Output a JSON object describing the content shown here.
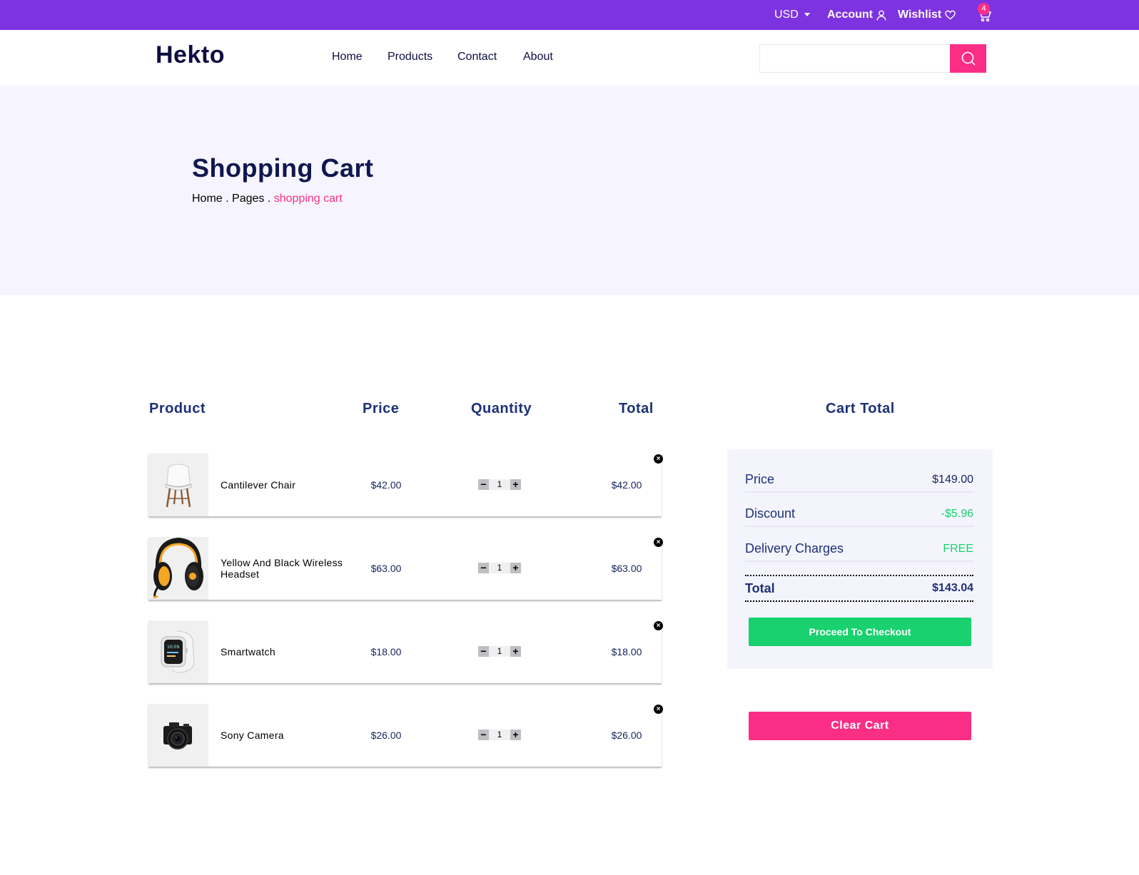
{
  "topbar": {
    "currency": "USD",
    "account": "Account",
    "wishlist": "Wishlist",
    "cart_count": "4",
    "bg_color": "#7e33e0"
  },
  "header": {
    "logo": "Hekto",
    "nav": [
      "Home",
      "Products",
      "Contact",
      "About"
    ],
    "search_placeholder": ""
  },
  "hero": {
    "title": "Shopping Cart",
    "breadcrumb": [
      "Home",
      "Pages",
      "shopping cart"
    ]
  },
  "table": {
    "headers": [
      "Product",
      "Price",
      "Quantity",
      "Total"
    ],
    "rows": [
      {
        "name": "Cantilever Chair",
        "price": "$42.00",
        "qty": "1",
        "total": "$42.00",
        "image_icon": "chair-image"
      },
      {
        "name": "Yellow And Black Wireless Headset",
        "price": "$63.00",
        "qty": "1",
        "total": "$63.00",
        "image_icon": "headset-image"
      },
      {
        "name": "Smartwatch",
        "price": "$18.00",
        "qty": "1",
        "total": "$18.00",
        "image_icon": "smartwatch-image"
      },
      {
        "name": "Sony Camera",
        "price": "$26.00",
        "qty": "1",
        "total": "$26.00",
        "image_icon": "camera-image"
      }
    ]
  },
  "cart_total": {
    "heading": "Cart Total",
    "price_label": "Price",
    "price_value": "$149.00",
    "discount_label": "Discount",
    "discount_value": "-$5.96",
    "delivery_label": "Delivery Charges",
    "delivery_value": "FREE",
    "total_label": "Total",
    "total_value": "$143.04",
    "checkout_label": "Proceed To Checkout",
    "clear_label": "Clear Cart"
  },
  "colors": {
    "accent_pink": "#fb2e86",
    "accent_green": "#19d16f",
    "navy": "#1d3178",
    "hero_bg": "#f6f5ff"
  }
}
